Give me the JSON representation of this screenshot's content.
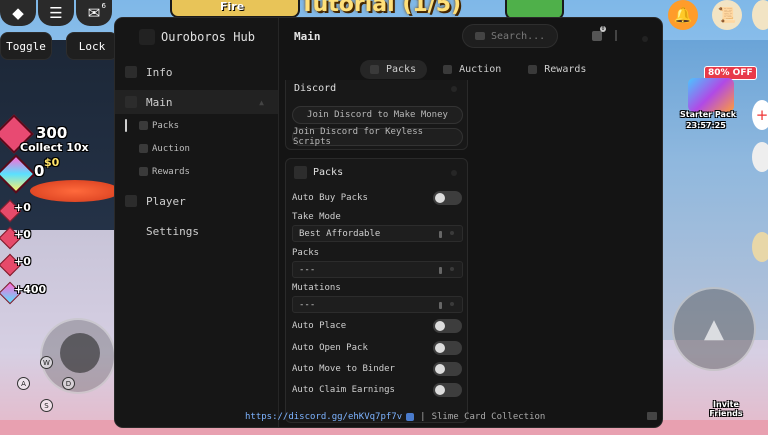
{
  "game": {
    "toggle_label": "Toggle",
    "lock_label": "Lock",
    "menu_badge": "6",
    "tutorial_text": "Tutorial (1/5)",
    "banner_text": "Fire",
    "gem_count": "300",
    "collect_label": "Collect 10x",
    "coin_count": "0",
    "coin_plus": "$0",
    "plus_values": [
      "+0",
      "+0",
      "+0",
      "+400"
    ],
    "offer_text": "80% OFF",
    "starter_pack_label": "Starter Pack",
    "starter_pack_timer": "23:57:25",
    "invite_label": "Invite Friends",
    "keys": [
      "W",
      "A",
      "D",
      "S"
    ],
    "menu_icon": "hamburger-icon",
    "chat_icon": "chat-icon",
    "bell_icon": "bell-icon",
    "jump_icon": "arrow-up-icon"
  },
  "hub": {
    "title": "Ouroboros Hub",
    "header_title": "Main",
    "search_placeholder": "Search...",
    "notification_count": "0",
    "nav": [
      {
        "label": "Info"
      },
      {
        "label": "Main"
      },
      {
        "label": "Player"
      },
      {
        "label": "Settings"
      }
    ],
    "sub_nav": [
      {
        "label": "Packs"
      },
      {
        "label": "Auction"
      },
      {
        "label": "Rewards"
      }
    ],
    "tabs": [
      {
        "label": "Packs"
      },
      {
        "label": "Auction"
      },
      {
        "label": "Rewards"
      }
    ],
    "discord_section": {
      "title": "Discord",
      "buttons": [
        "Join Discord to Make Money",
        "Join Discord for Keyless Scripts"
      ]
    },
    "packs_section": {
      "title": "Packs",
      "auto_buy_label": "Auto Buy Packs",
      "take_mode_label": "Take Mode",
      "take_mode_value": "Best Affordable",
      "packs_label": "Packs",
      "packs_value": "---",
      "mutations_label": "Mutations",
      "mutations_value": "---",
      "toggles": [
        "Auto Place",
        "Auto Open Pack",
        "Auto Move to Binder",
        "Auto Claim Earnings"
      ]
    },
    "footer": {
      "link": "https://discord.gg/ehKVq7pf7v",
      "separator": "|",
      "game_name": "Slime Card Collection"
    }
  }
}
